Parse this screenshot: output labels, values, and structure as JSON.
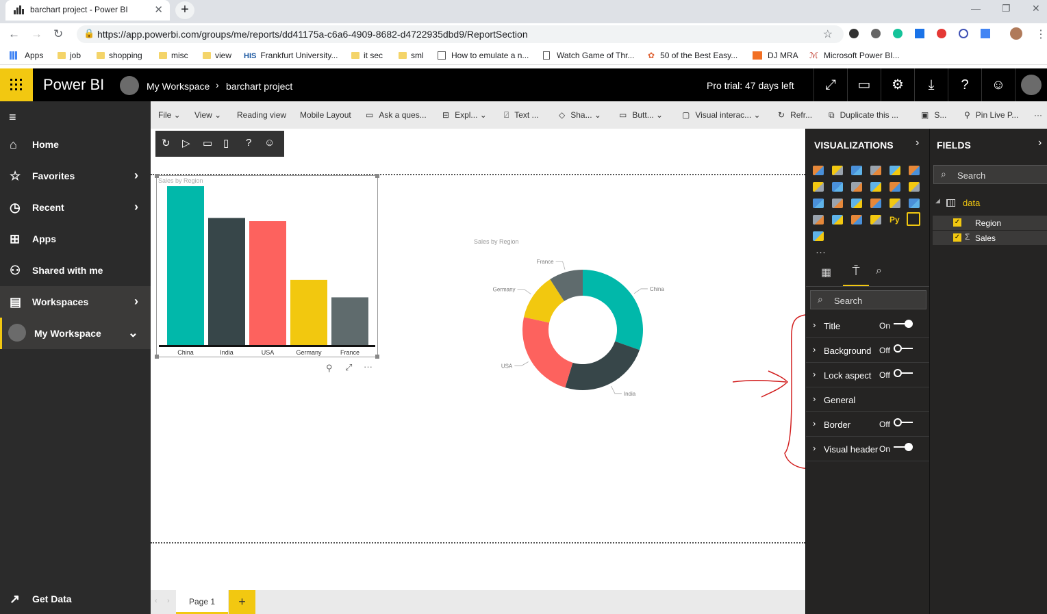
{
  "browser": {
    "tab_title": "barchart project - Power BI",
    "url": "https://app.powerbi.com/groups/me/reports/dd41175a-c6a6-4909-8682-d4722935dbd9/ReportSection",
    "bookmarks": [
      "Apps",
      "job",
      "shopping",
      "misc",
      "view",
      "Frankfurt University...",
      "it sec",
      "sml",
      "How to emulate a n...",
      "Watch Game of Thr...",
      "50 of the Best Easy...",
      "DJ MRA",
      "Microsoft Power BI..."
    ]
  },
  "header": {
    "app_name": "Power BI",
    "workspace": "My Workspace",
    "report": "barchart project",
    "trial": "Pro trial: 47 days left"
  },
  "nav": {
    "items": [
      {
        "label": "Home",
        "icon": "home-icon"
      },
      {
        "label": "Favorites",
        "icon": "star-icon"
      },
      {
        "label": "Recent",
        "icon": "clock-icon"
      },
      {
        "label": "Apps",
        "icon": "apps-icon"
      },
      {
        "label": "Shared with me",
        "icon": "shared-icon"
      },
      {
        "label": "Workspaces",
        "icon": "workspaces-icon"
      },
      {
        "label": "My Workspace",
        "icon": "avatar-icon"
      }
    ],
    "get_data": "Get Data"
  },
  "toolbar": [
    "File",
    "View",
    "Reading view",
    "Mobile Layout",
    "Ask a ques...",
    "Expl...",
    "Text ...",
    "Sha...",
    "Butt...",
    "Visual interac...",
    "Refr...",
    "Duplicate this ...",
    "S...",
    "Pin Live P..."
  ],
  "pages": {
    "current": "Page 1",
    "add": "+"
  },
  "viz_pane": {
    "title": "VISUALIZATIONS",
    "search_placeholder": "Search",
    "format_items": [
      {
        "label": "Title",
        "state": "On"
      },
      {
        "label": "Background",
        "state": "Off"
      },
      {
        "label": "Lock aspect",
        "state": "Off"
      },
      {
        "label": "General",
        "state": ""
      },
      {
        "label": "Border",
        "state": "Off"
      },
      {
        "label": "Visual header",
        "state": "On"
      }
    ]
  },
  "fields_pane": {
    "title": "FIELDS",
    "search_placeholder": "Search",
    "table": "data",
    "fields": [
      "Region",
      "Sales"
    ]
  },
  "colors": {
    "brand": "#f2c811",
    "teal": "#01b8aa",
    "dark": "#374649",
    "red": "#fd625e",
    "yellow": "#f2c80f",
    "gray": "#5f6b6d"
  },
  "chart_data": [
    {
      "type": "bar",
      "title": "Sales by Region",
      "categories": [
        "China",
        "India",
        "USA",
        "Germany",
        "France"
      ],
      "values": [
        100,
        80,
        78,
        41,
        30
      ]
    },
    {
      "type": "pie",
      "title": "Sales by Region",
      "categories": [
        "China",
        "India",
        "USA",
        "Germany",
        "France"
      ],
      "values": [
        100,
        80,
        78,
        41,
        30
      ]
    }
  ]
}
